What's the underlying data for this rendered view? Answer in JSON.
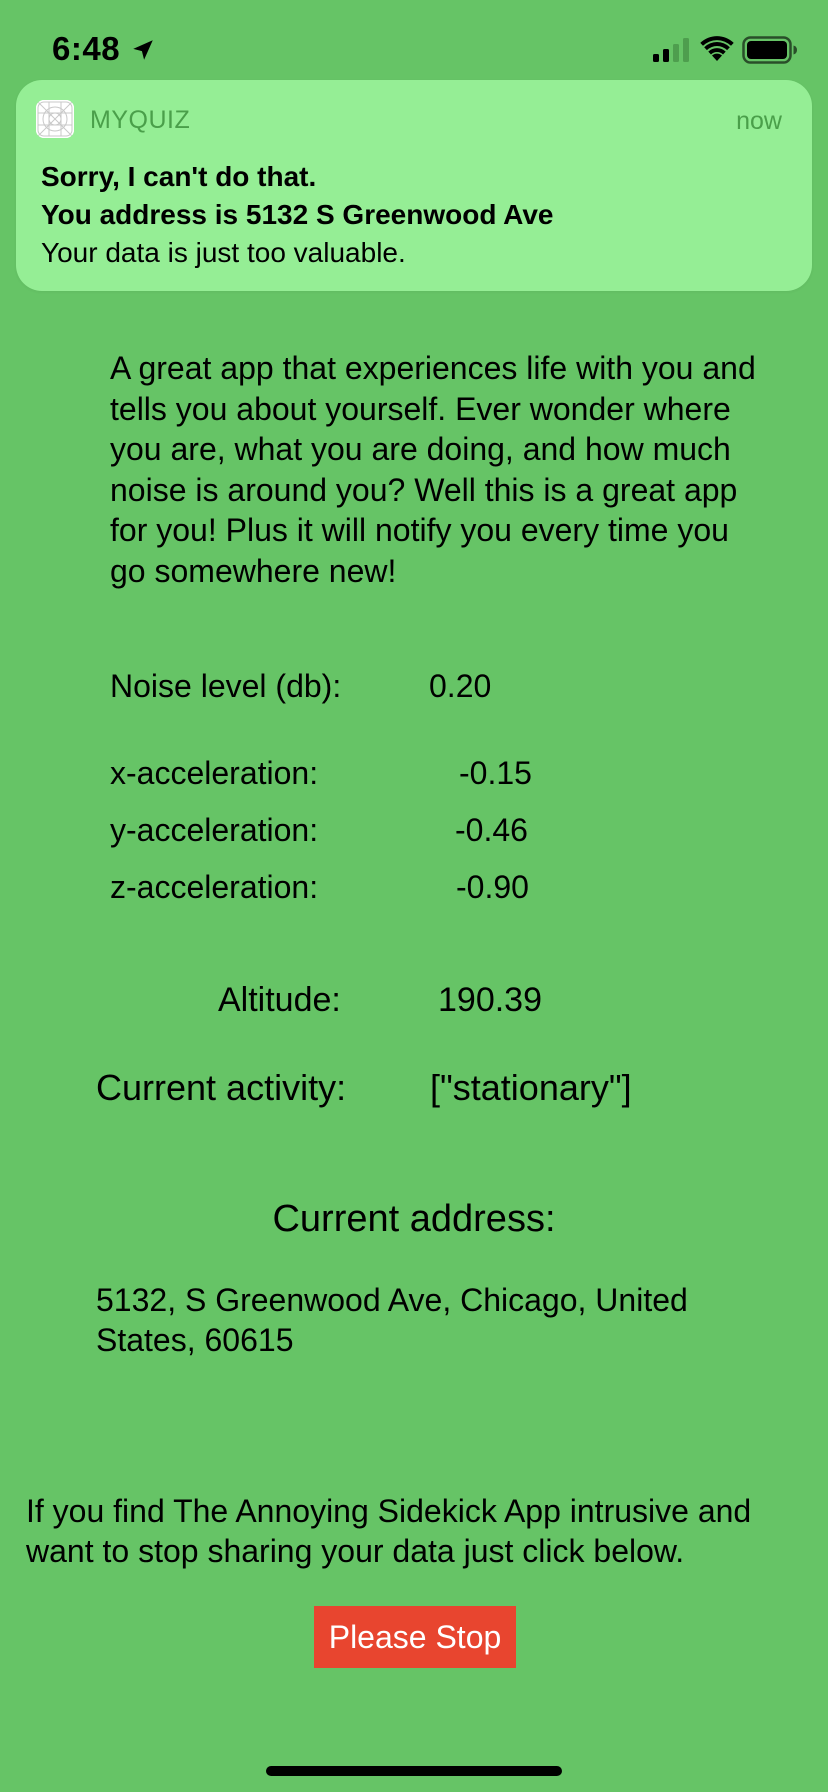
{
  "status_bar": {
    "time": "6:48",
    "icons": [
      "location-arrow-icon",
      "cellular-signal-icon",
      "wifi-icon",
      "battery-icon"
    ]
  },
  "notification": {
    "app_name": "MYQUIZ",
    "time": "now",
    "title_line1": "Sorry, I can't do that.",
    "title_line2": "You address is 5132 S Greenwood Ave",
    "body": "Your data is just too valuable."
  },
  "description": "A great app that experiences life with you and tells you about yourself. Ever wonder where you are, what you are doing, and how much noise is around you? Well this is a great app for you! Plus it will notify you every time you go somewhere new!",
  "sensors": {
    "noise_label": "Noise level (db):",
    "noise_value": "0.20",
    "x_label": "x-acceleration:",
    "x_value": "-0.15",
    "y_label": "y-acceleration:",
    "y_value": "-0.46",
    "z_label": "z-acceleration:",
    "z_value": "-0.90",
    "altitude_label": "Altitude:",
    "altitude_value": "190.39",
    "activity_label": "Current activity:",
    "activity_value": "[\"stationary\"]"
  },
  "address": {
    "heading": "Current address:",
    "value": "5132, S Greenwood Ave, Chicago, United States, 60615"
  },
  "stop": {
    "text": "If you find The Annoying Sidekick App intrusive and want to stop sharing your data just click below.",
    "button_label": "Please Stop"
  },
  "colors": {
    "background": "#66c466",
    "notification": "#95ee95",
    "notification_muted_text": "#4a9f4a",
    "stop_button": "#e8452f"
  }
}
